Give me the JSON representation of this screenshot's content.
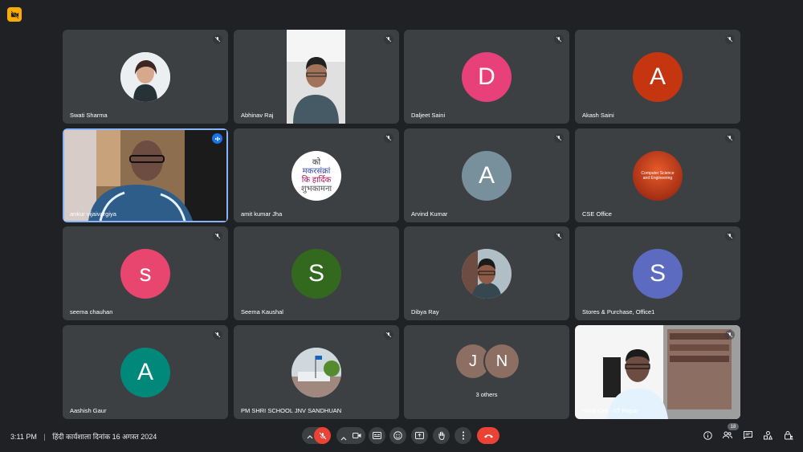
{
  "participants": [
    {
      "name": "Swati Sharma",
      "muted": true
    },
    {
      "name": "Abhinav Raj",
      "muted": true
    },
    {
      "name": "Daljeet Saini",
      "muted": true,
      "initial": "D",
      "color": "#e84078"
    },
    {
      "name": "Akash Saini",
      "muted": true,
      "initial": "A",
      "color": "#c5350f"
    },
    {
      "name": "ankur vijaivargiya",
      "speaking": true
    },
    {
      "name": "amit kumar Jha",
      "muted": true,
      "avatar_lines": [
        "को",
        "मकरसंक्रां",
        "कि हार्दिक",
        "शुभकामना"
      ]
    },
    {
      "name": "Arvind Kumar",
      "muted": true,
      "initial": "A",
      "color": "#78909c"
    },
    {
      "name": "CSE Office",
      "muted": true,
      "avatar_text": "Computer Science and Engineering"
    },
    {
      "name": "seema chauhan",
      "muted": true,
      "initial": "s",
      "color": "#e8456f"
    },
    {
      "name": "Seema Kaushal",
      "muted": false,
      "initial": "S",
      "color": "#33691e"
    },
    {
      "name": "Dibya Ray",
      "muted": true
    },
    {
      "name": "Stores & Purchase, Office1",
      "muted": true,
      "initial": "S",
      "color": "#5c6bc0"
    },
    {
      "name": "Aashish Gaur",
      "muted": true,
      "initial": "A",
      "color": "#00897b"
    },
    {
      "name": "PM SHRI SCHOOL JNV SANDHUAN",
      "muted": true
    },
    {
      "name": "3 others",
      "initials": [
        "J",
        "N"
      ],
      "colors": [
        "#8d6e63",
        "#8d6e63"
      ]
    },
    {
      "name": "Hindi Cell - IIT Ropar",
      "muted": true
    }
  ],
  "bottom_bar": {
    "time": "3:11 PM",
    "separator": "|",
    "meeting_title": "हिंदी कार्यशाला दिनांक 16 अगस्त 2024",
    "participant_count": "18",
    "end_call_color": "#ea4335"
  }
}
